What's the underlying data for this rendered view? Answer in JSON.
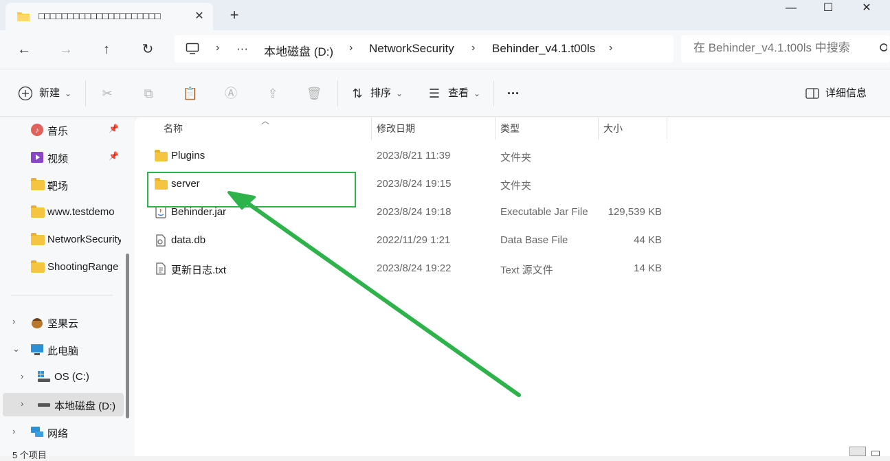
{
  "tab": {
    "title": "□□□□□□□□□□□□□□□□□□□□□",
    "close": "✕",
    "new": "+"
  },
  "window": {
    "minimize": "—",
    "maximize": "☐",
    "close": "✕"
  },
  "nav": {
    "back": "←",
    "forward": "→",
    "up": "↑",
    "refresh": "↻"
  },
  "address": {
    "pc_icon": "pc-icon",
    "overflow": "···",
    "crumbs": [
      "本地磁盘 (D:)",
      "NetworkSecurity",
      "Behinder_v4.1.t00ls"
    ],
    "sep": "›"
  },
  "search": {
    "placeholder": "在 Behinder_v4.1.t00ls 中搜索"
  },
  "toolbar": {
    "new_label": "新建",
    "sort_label": "排序",
    "view_label": "查看",
    "more": "···",
    "details_label": "详细信息",
    "dropdown": "⌄"
  },
  "sidebar": {
    "items": [
      {
        "label": "音乐",
        "icon": "music-icon",
        "pinned": true
      },
      {
        "label": "视频",
        "icon": "video-icon",
        "pinned": true
      },
      {
        "label": "靶场",
        "icon": "folder-icon"
      },
      {
        "label": "www.testdemo",
        "icon": "folder-icon"
      },
      {
        "label": "NetworkSecurity",
        "icon": "folder-icon"
      },
      {
        "label": "ShootingRange",
        "icon": "folder-icon"
      },
      {
        "label": "坚果云",
        "icon": "nutstore-icon"
      },
      {
        "label": "此电脑",
        "icon": "computer-icon"
      },
      {
        "label": "OS (C:)",
        "icon": "drive-icon"
      },
      {
        "label": "本地磁盘 (D:)",
        "icon": "drive-icon"
      },
      {
        "label": "网络",
        "icon": "network-icon"
      }
    ],
    "pin_glyph": "📌",
    "chev_right": "›",
    "chev_down": "⌄"
  },
  "columns": {
    "name": "名称",
    "modified": "修改日期",
    "type": "类型",
    "size": "大小"
  },
  "files": [
    {
      "name": "Plugins",
      "modified": "2023/8/21 11:39",
      "type": "文件夹",
      "size": "",
      "icon": "folder-icon"
    },
    {
      "name": "server",
      "modified": "2023/8/24 19:15",
      "type": "文件夹",
      "size": "",
      "icon": "folder-icon"
    },
    {
      "name": "Behinder.jar",
      "modified": "2023/8/24 19:18",
      "type": "Executable Jar File",
      "size": "129,539 KB",
      "icon": "java-jar-icon"
    },
    {
      "name": "data.db",
      "modified": "2022/11/29 1:21",
      "type": "Data Base File",
      "size": "44 KB",
      "icon": "db-file-icon"
    },
    {
      "name": "更新日志.txt",
      "modified": "2023/8/24 19:22",
      "type": "Text 源文件",
      "size": "14 KB",
      "icon": "text-file-icon"
    }
  ],
  "status": {
    "count": "5 个项目"
  },
  "colors": {
    "highlight": "#2db34a",
    "folder": "#f5c542",
    "background": "#f3f3f3"
  }
}
